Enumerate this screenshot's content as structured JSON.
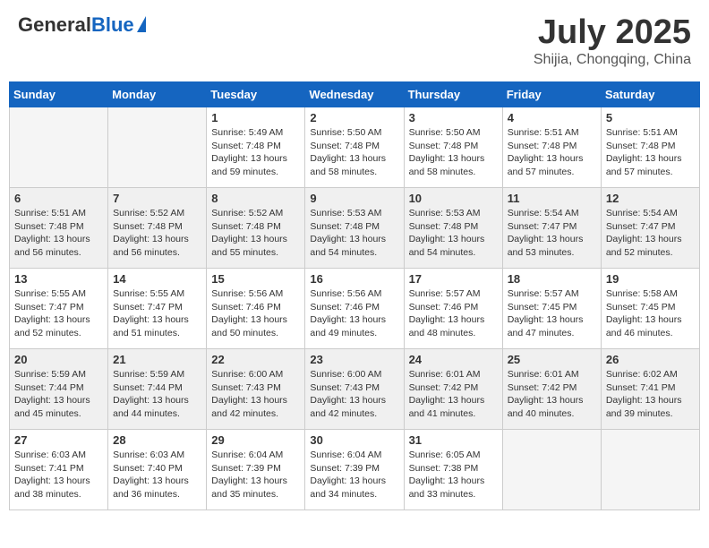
{
  "header": {
    "logo_general": "General",
    "logo_blue": "Blue",
    "month": "July 2025",
    "location": "Shijia, Chongqing, China"
  },
  "days_of_week": [
    "Sunday",
    "Monday",
    "Tuesday",
    "Wednesday",
    "Thursday",
    "Friday",
    "Saturday"
  ],
  "weeks": [
    {
      "shaded": false,
      "days": [
        {
          "number": "",
          "empty": true
        },
        {
          "number": "",
          "empty": true
        },
        {
          "number": "1",
          "sunrise": "Sunrise: 5:49 AM",
          "sunset": "Sunset: 7:48 PM",
          "daylight": "Daylight: 13 hours and 59 minutes."
        },
        {
          "number": "2",
          "sunrise": "Sunrise: 5:50 AM",
          "sunset": "Sunset: 7:48 PM",
          "daylight": "Daylight: 13 hours and 58 minutes."
        },
        {
          "number": "3",
          "sunrise": "Sunrise: 5:50 AM",
          "sunset": "Sunset: 7:48 PM",
          "daylight": "Daylight: 13 hours and 58 minutes."
        },
        {
          "number": "4",
          "sunrise": "Sunrise: 5:51 AM",
          "sunset": "Sunset: 7:48 PM",
          "daylight": "Daylight: 13 hours and 57 minutes."
        },
        {
          "number": "5",
          "sunrise": "Sunrise: 5:51 AM",
          "sunset": "Sunset: 7:48 PM",
          "daylight": "Daylight: 13 hours and 57 minutes."
        }
      ]
    },
    {
      "shaded": true,
      "days": [
        {
          "number": "6",
          "sunrise": "Sunrise: 5:51 AM",
          "sunset": "Sunset: 7:48 PM",
          "daylight": "Daylight: 13 hours and 56 minutes."
        },
        {
          "number": "7",
          "sunrise": "Sunrise: 5:52 AM",
          "sunset": "Sunset: 7:48 PM",
          "daylight": "Daylight: 13 hours and 56 minutes."
        },
        {
          "number": "8",
          "sunrise": "Sunrise: 5:52 AM",
          "sunset": "Sunset: 7:48 PM",
          "daylight": "Daylight: 13 hours and 55 minutes."
        },
        {
          "number": "9",
          "sunrise": "Sunrise: 5:53 AM",
          "sunset": "Sunset: 7:48 PM",
          "daylight": "Daylight: 13 hours and 54 minutes."
        },
        {
          "number": "10",
          "sunrise": "Sunrise: 5:53 AM",
          "sunset": "Sunset: 7:48 PM",
          "daylight": "Daylight: 13 hours and 54 minutes."
        },
        {
          "number": "11",
          "sunrise": "Sunrise: 5:54 AM",
          "sunset": "Sunset: 7:47 PM",
          "daylight": "Daylight: 13 hours and 53 minutes."
        },
        {
          "number": "12",
          "sunrise": "Sunrise: 5:54 AM",
          "sunset": "Sunset: 7:47 PM",
          "daylight": "Daylight: 13 hours and 52 minutes."
        }
      ]
    },
    {
      "shaded": false,
      "days": [
        {
          "number": "13",
          "sunrise": "Sunrise: 5:55 AM",
          "sunset": "Sunset: 7:47 PM",
          "daylight": "Daylight: 13 hours and 52 minutes."
        },
        {
          "number": "14",
          "sunrise": "Sunrise: 5:55 AM",
          "sunset": "Sunset: 7:47 PM",
          "daylight": "Daylight: 13 hours and 51 minutes."
        },
        {
          "number": "15",
          "sunrise": "Sunrise: 5:56 AM",
          "sunset": "Sunset: 7:46 PM",
          "daylight": "Daylight: 13 hours and 50 minutes."
        },
        {
          "number": "16",
          "sunrise": "Sunrise: 5:56 AM",
          "sunset": "Sunset: 7:46 PM",
          "daylight": "Daylight: 13 hours and 49 minutes."
        },
        {
          "number": "17",
          "sunrise": "Sunrise: 5:57 AM",
          "sunset": "Sunset: 7:46 PM",
          "daylight": "Daylight: 13 hours and 48 minutes."
        },
        {
          "number": "18",
          "sunrise": "Sunrise: 5:57 AM",
          "sunset": "Sunset: 7:45 PM",
          "daylight": "Daylight: 13 hours and 47 minutes."
        },
        {
          "number": "19",
          "sunrise": "Sunrise: 5:58 AM",
          "sunset": "Sunset: 7:45 PM",
          "daylight": "Daylight: 13 hours and 46 minutes."
        }
      ]
    },
    {
      "shaded": true,
      "days": [
        {
          "number": "20",
          "sunrise": "Sunrise: 5:59 AM",
          "sunset": "Sunset: 7:44 PM",
          "daylight": "Daylight: 13 hours and 45 minutes."
        },
        {
          "number": "21",
          "sunrise": "Sunrise: 5:59 AM",
          "sunset": "Sunset: 7:44 PM",
          "daylight": "Daylight: 13 hours and 44 minutes."
        },
        {
          "number": "22",
          "sunrise": "Sunrise: 6:00 AM",
          "sunset": "Sunset: 7:43 PM",
          "daylight": "Daylight: 13 hours and 42 minutes."
        },
        {
          "number": "23",
          "sunrise": "Sunrise: 6:00 AM",
          "sunset": "Sunset: 7:43 PM",
          "daylight": "Daylight: 13 hours and 42 minutes."
        },
        {
          "number": "24",
          "sunrise": "Sunrise: 6:01 AM",
          "sunset": "Sunset: 7:42 PM",
          "daylight": "Daylight: 13 hours and 41 minutes."
        },
        {
          "number": "25",
          "sunrise": "Sunrise: 6:01 AM",
          "sunset": "Sunset: 7:42 PM",
          "daylight": "Daylight: 13 hours and 40 minutes."
        },
        {
          "number": "26",
          "sunrise": "Sunrise: 6:02 AM",
          "sunset": "Sunset: 7:41 PM",
          "daylight": "Daylight: 13 hours and 39 minutes."
        }
      ]
    },
    {
      "shaded": false,
      "days": [
        {
          "number": "27",
          "sunrise": "Sunrise: 6:03 AM",
          "sunset": "Sunset: 7:41 PM",
          "daylight": "Daylight: 13 hours and 38 minutes."
        },
        {
          "number": "28",
          "sunrise": "Sunrise: 6:03 AM",
          "sunset": "Sunset: 7:40 PM",
          "daylight": "Daylight: 13 hours and 36 minutes."
        },
        {
          "number": "29",
          "sunrise": "Sunrise: 6:04 AM",
          "sunset": "Sunset: 7:39 PM",
          "daylight": "Daylight: 13 hours and 35 minutes."
        },
        {
          "number": "30",
          "sunrise": "Sunrise: 6:04 AM",
          "sunset": "Sunset: 7:39 PM",
          "daylight": "Daylight: 13 hours and 34 minutes."
        },
        {
          "number": "31",
          "sunrise": "Sunrise: 6:05 AM",
          "sunset": "Sunset: 7:38 PM",
          "daylight": "Daylight: 13 hours and 33 minutes."
        },
        {
          "number": "",
          "empty": true
        },
        {
          "number": "",
          "empty": true
        }
      ]
    }
  ]
}
